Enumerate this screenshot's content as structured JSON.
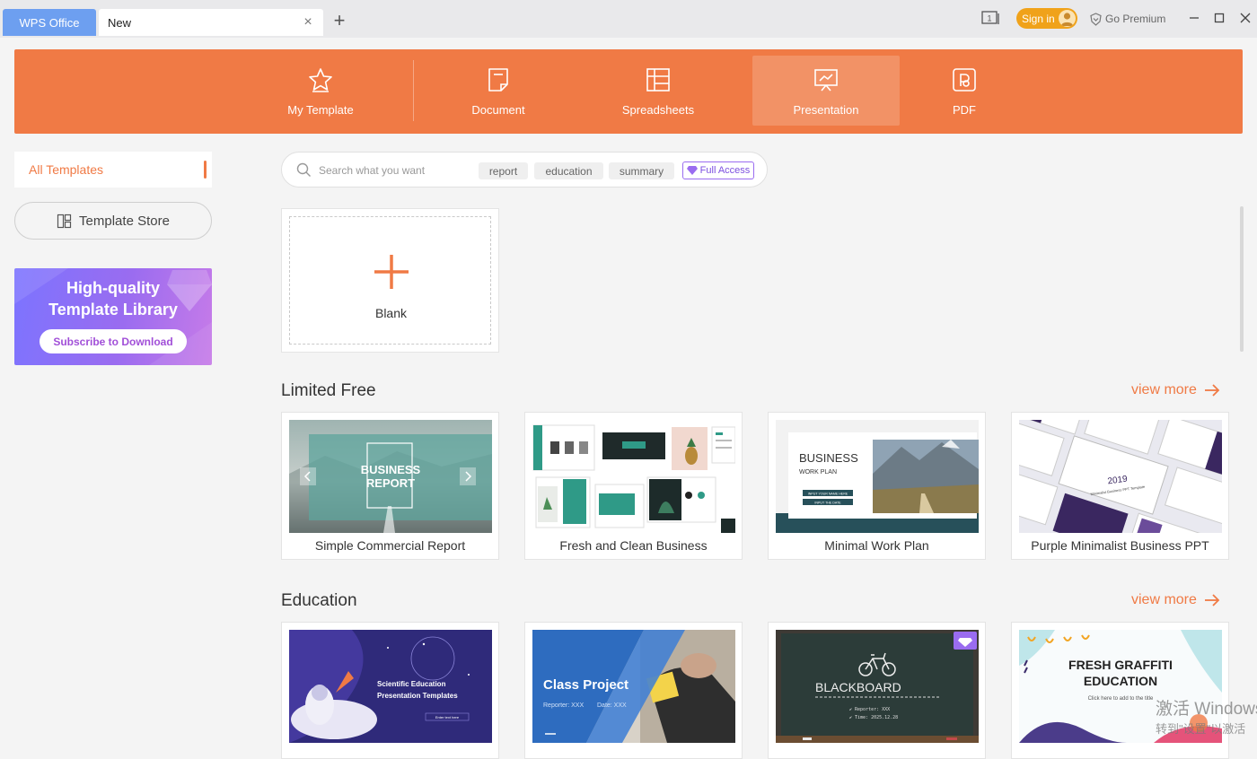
{
  "titlebar": {
    "app_tab": "WPS Office",
    "doc_tab": "New",
    "close_glyph": "×",
    "add_glyph": "+",
    "signin_label": "Sign in",
    "premium_label": "Go Premium",
    "screen_badge": "1"
  },
  "categories": [
    {
      "label": "My Template",
      "icon": "star-icon"
    },
    {
      "label": "Document",
      "icon": "document-icon"
    },
    {
      "label": "Spreadsheets",
      "icon": "spreadsheet-icon"
    },
    {
      "label": "Presentation",
      "icon": "presentation-icon",
      "active": true
    },
    {
      "label": "PDF",
      "icon": "pdf-icon"
    }
  ],
  "sidebar": {
    "all_templates": "All Templates",
    "template_store": "Template Store",
    "promo_line1": "High-quality",
    "promo_line2": "Template Library",
    "promo_button": "Subscribe to Download"
  },
  "search": {
    "placeholder": "Search what you want",
    "chips": [
      "report",
      "education",
      "summary"
    ],
    "full_access": "Full Access"
  },
  "blank": {
    "label": "Blank"
  },
  "sections": [
    {
      "title": "Limited Free",
      "view_more": "view more",
      "cards": [
        {
          "label": "Simple Commercial Report",
          "thumb_text": [
            "BUSINESS",
            "REPORT"
          ]
        },
        {
          "label": "Fresh and Clean Business"
        },
        {
          "label": "Minimal Work Plan",
          "thumb_text": [
            "BUSINESS",
            "WORK PLAN",
            "INPUT YOUR NAME HERE",
            "INPUT THE DATE"
          ]
        },
        {
          "label": "Purple Minimalist Business PPT",
          "thumb_text": [
            "2019",
            "Minimalist Business PPT Template"
          ]
        }
      ]
    },
    {
      "title": "Education",
      "view_more": "view more",
      "cards": [
        {
          "thumb_text": [
            "Scientific Education",
            "Presentation Templates",
            "Enter text here"
          ]
        },
        {
          "thumb_text": [
            "Class Project",
            "Reporter: XXX",
            "Date: XXX"
          ]
        },
        {
          "thumb_text": [
            "BLACKBOARD",
            "✔ Reporter: XXX",
            "✔ Time: 2025.12.28"
          ]
        },
        {
          "thumb_text": [
            "FRESH GRAFFITI",
            "EDUCATION",
            "Click here to add to the title"
          ]
        }
      ]
    }
  ],
  "watermark": {
    "line1": "激活 Windows",
    "line2": "转到\"设置\"以激活"
  },
  "colors": {
    "accent": "#f07a45",
    "tab_blue": "#6d9ff0",
    "signin": "#f0a21a",
    "promo": "#9a6cf0"
  }
}
